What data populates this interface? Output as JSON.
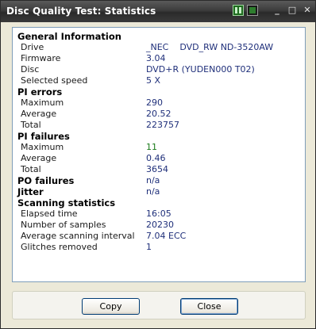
{
  "window": {
    "title": "Disc Quality Test: Statistics",
    "controls": {
      "minimize": "_",
      "maximize": "□",
      "close": "✕"
    },
    "skin_icons": [
      "skin-green-icon",
      "skin-dark-icon"
    ]
  },
  "statistics": {
    "general_information": {
      "heading": "General Information",
      "drive_label": "Drive",
      "drive_value": "_NEC    DVD_RW ND-3520AW",
      "firmware_label": "Firmware",
      "firmware_value": "3.04",
      "disc_label": "Disc",
      "disc_value": "DVD+R (YUDEN000 T02)",
      "speed_label": "Selected speed",
      "speed_value": "5 X"
    },
    "pi_errors": {
      "heading": "PI errors",
      "maximum_label": "Maximum",
      "maximum_value": "290",
      "average_label": "Average",
      "average_value": "20.52",
      "total_label": "Total",
      "total_value": "223757"
    },
    "pi_failures": {
      "heading": "PI failures",
      "maximum_label": "Maximum",
      "maximum_value": "11",
      "average_label": "Average",
      "average_value": "0.46",
      "total_label": "Total",
      "total_value": "3654"
    },
    "po_failures": {
      "heading": "PO failures",
      "value": "n/a"
    },
    "jitter": {
      "heading": "Jitter",
      "value": "n/a"
    },
    "scanning_statistics": {
      "heading": "Scanning statistics",
      "elapsed_label": "Elapsed time",
      "elapsed_value": "16:05",
      "samples_label": "Number of samples",
      "samples_value": "20230",
      "interval_label": "Average scanning interval",
      "interval_value": "7.04 ECC",
      "glitches_label": "Glitches removed",
      "glitches_value": "1"
    }
  },
  "buttons": {
    "copy_label": "Copy",
    "close_label": "Close"
  },
  "colors": {
    "value_text": "#1f2f7a",
    "highlight_value": "#1a7a1a",
    "titlebar": "#3c3c3c"
  }
}
